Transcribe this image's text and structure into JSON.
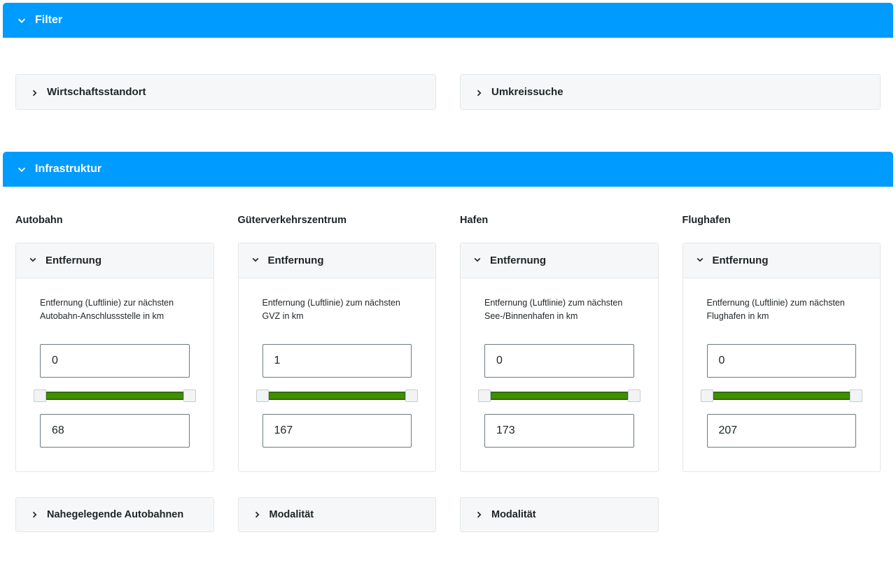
{
  "filter": {
    "title": "Filter",
    "panels": {
      "wirtschaft": "Wirtschaftsstandort",
      "umkreis": "Umkreissuche"
    }
  },
  "infra": {
    "title": "Infrastruktur",
    "columns": [
      {
        "id": "autobahn",
        "heading": "Autobahn",
        "card_title": "Entfernung",
        "desc": "Entfernung (Luftlinie) zur nächsten Autobahn-Anschlussstelle in km",
        "min": "0",
        "max": "68",
        "lower_panel": "Nahegelegende Autobahnen"
      },
      {
        "id": "gvz",
        "heading": "Güterverkehrszentrum",
        "card_title": "Entfernung",
        "desc": "Entfernung (Luftlinie) zum nächsten GVZ in km",
        "min": "1",
        "max": "167",
        "lower_panel": "Modalität"
      },
      {
        "id": "hafen",
        "heading": "Hafen",
        "card_title": "Entfernung",
        "desc": "Entfernung (Luftlinie) zum nächsten See-/Binnenhafen in km",
        "min": "0",
        "max": "173",
        "lower_panel": "Modalität"
      },
      {
        "id": "flughafen",
        "heading": "Flughafen",
        "card_title": "Entfernung",
        "desc": "Entfernung (Luftlinie) zum nächsten Flughafen in km",
        "min": "0",
        "max": "207",
        "lower_panel": ""
      }
    ]
  }
}
